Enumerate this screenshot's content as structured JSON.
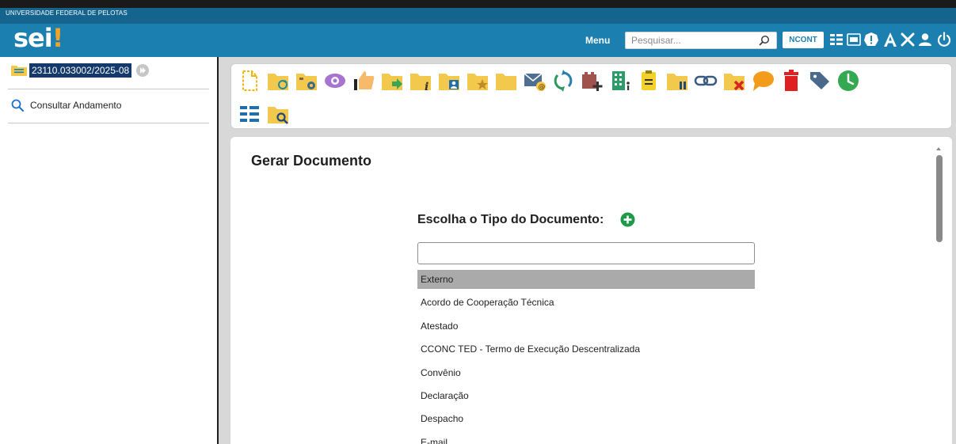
{
  "header": {
    "institution": "UNIVERSIDADE FEDERAL DE PELOTAS",
    "logo_text": "sei",
    "logo_mark": "!",
    "menu_label": "Menu",
    "search_placeholder": "Pesquisar...",
    "unit_badge": "NCONT",
    "icons": [
      "search-icon",
      "list-icon",
      "calculator-icon",
      "alert-icon",
      "font-size-icon",
      "tools-icon",
      "user-icon",
      "power-icon"
    ],
    "accent_color": "#1b7fb0",
    "strip_color": "#14648d"
  },
  "sidebar": {
    "process_number": "23110.033002/2025-08",
    "consult_label": "Consultar Andamento"
  },
  "toolbar": {
    "icons": [
      "new-document-icon",
      "folder-sync-icon",
      "folder-settings-icon",
      "eye-icon",
      "thumbs-up-icon",
      "folder-send-icon",
      "folder-info-icon",
      "folder-user-icon",
      "folder-star-icon",
      "folder-icon",
      "email-icon",
      "refresh-icon",
      "add-block-icon",
      "building-icon",
      "clipboard-icon",
      "folder-pause-icon",
      "link-icon",
      "folder-close-icon",
      "comment-icon",
      "trash-icon",
      "tag-icon",
      "clock-icon",
      "list-view-icon",
      "folder-search-icon"
    ]
  },
  "main": {
    "title": "Gerar Documento",
    "choose_label": "Escolha o Tipo do Documento:",
    "filter_value": "",
    "document_types": [
      "Externo",
      "Acordo de Cooperação Técnica",
      "Atestado",
      "CCONC TED - Termo de Execução Descentralizada",
      "Convênio",
      "Declaração",
      "Despacho",
      "E-mail"
    ],
    "selected_index": 0
  }
}
